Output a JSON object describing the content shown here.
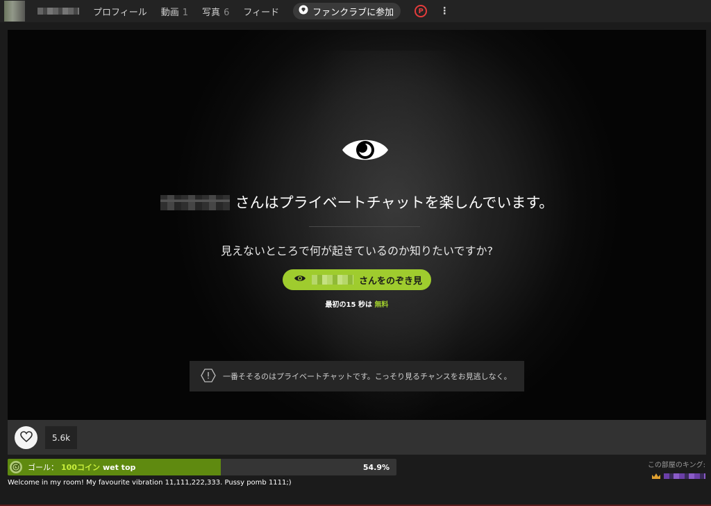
{
  "nav": {
    "profile": "プロフィール",
    "videos": "動画",
    "videos_count": "1",
    "photos": "写真",
    "photos_count": "6",
    "feed": "フィード",
    "fanclub": "ファンクラブに参加"
  },
  "overlay": {
    "headline_suffix": "さんはプライベートチャットを楽しんでいます。",
    "question": "見えないところで何が起きているのか知りたいですか?",
    "peek_button_suffix": "さんをのぞき見",
    "free_prefix": "最初の15 秒は",
    "free_word": "無料",
    "info": "一番そそるのはプライベートチャットです。こっそり見るチャンスをお見逃しなく。"
  },
  "likes": {
    "count": "5.6k"
  },
  "goal": {
    "label": "ゴール：",
    "amount": "100コイン",
    "subject": "wet top",
    "percent_text": "54.9%",
    "progress": 0.549
  },
  "welcome": "Welcome in my room! My favourite vibration 11,111,222,333. Pussy pomb 1111;)",
  "king": {
    "label": "この部屋のキング:"
  },
  "colors": {
    "accent": "#9fcc2e",
    "goal_fill": "#5f8a10",
    "ticket": "#e53c3c",
    "crown": "#e0a030"
  },
  "icons": [
    "diamond-icon",
    "ticket-icon",
    "more-vertical-icon",
    "eye-icon",
    "alert-hexagon-icon",
    "heart-icon",
    "target-icon",
    "crown-icon"
  ]
}
